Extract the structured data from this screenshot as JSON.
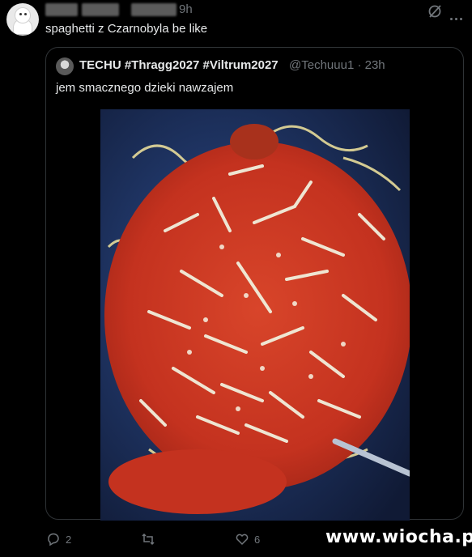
{
  "post": {
    "time": "9h",
    "text": "spaghetti z Czarnobyla be like"
  },
  "quote": {
    "author": "TECHU #Thragg2027 #Viltrum2027",
    "handle_time": "@Techuuu1 · 23h",
    "text": "jem smacznego dzieki nawzajem"
  },
  "actions": {
    "replies": "2",
    "reposts": "",
    "likes": "6"
  },
  "watermark": "www.wiocha.pl",
  "icons": [
    "avatar-ghost",
    "grok-icon",
    "more-icon",
    "reply-icon",
    "repost-icon",
    "like-icon"
  ],
  "colors": {
    "background": "#000000",
    "text": "#e7e9ea",
    "muted": "#71767b",
    "border": "#2f3336"
  }
}
